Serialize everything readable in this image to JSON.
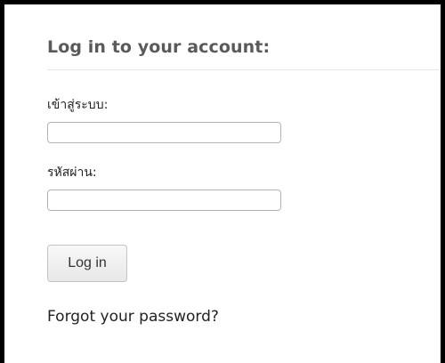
{
  "login_panel": {
    "heading": "Log in to your account:",
    "username": {
      "label": "เข้าสู่ระบบ:",
      "value": ""
    },
    "password": {
      "label": "รหัสผ่าน:",
      "value": ""
    },
    "submit_label": "Log in",
    "forgot_password_text": "Forgot your password?"
  }
}
